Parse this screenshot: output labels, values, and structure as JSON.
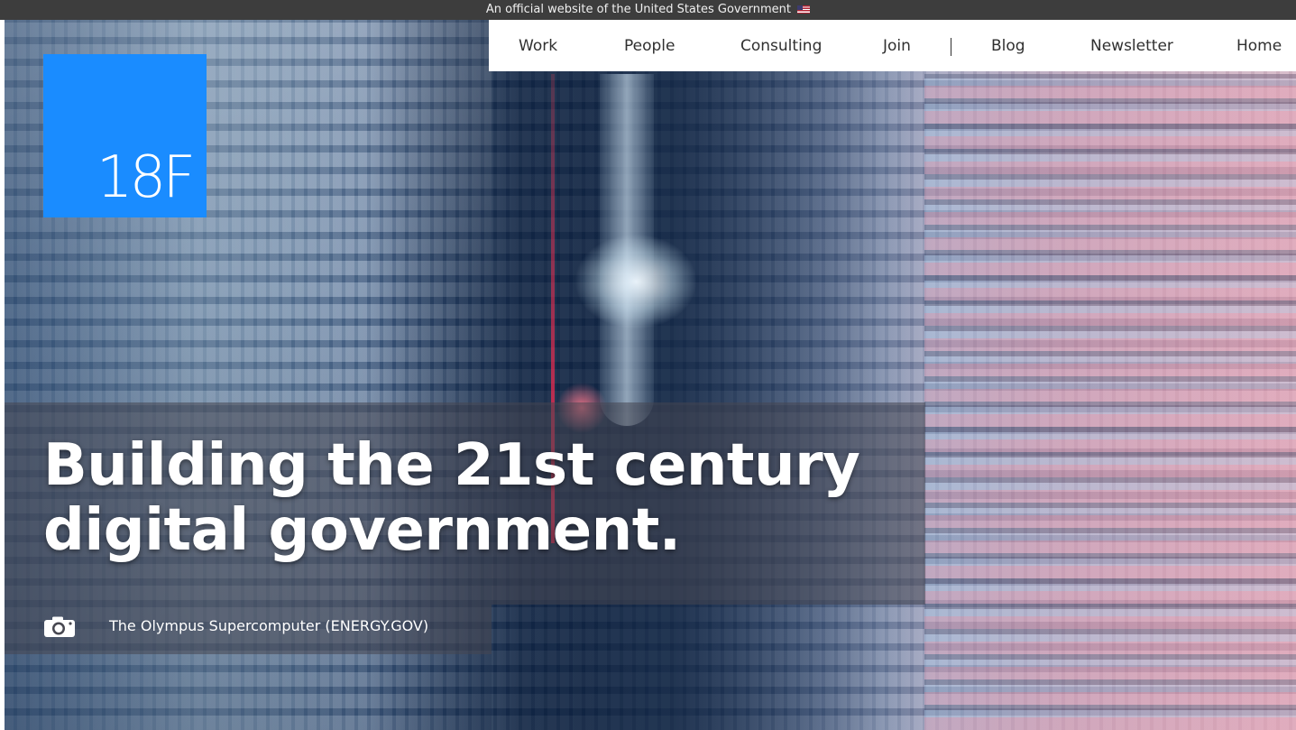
{
  "gov_banner": {
    "text": "An official website of the United States Government",
    "flag_icon": "us-flag-icon"
  },
  "logo": {
    "text": "18F",
    "color": "#1a8cff"
  },
  "nav": {
    "items": [
      {
        "label": "Work"
      },
      {
        "label": "People"
      },
      {
        "label": "Consulting"
      },
      {
        "label": "Join"
      },
      {
        "label": "Blog"
      },
      {
        "label": "Newsletter"
      },
      {
        "label": "Home"
      }
    ],
    "separator": "|"
  },
  "hero": {
    "headline_line1": "Building the 21st century",
    "headline_line2": "digital government.",
    "caption_icon": "camera-icon",
    "caption": "The Olympus Supercomputer (ENERGY.GOV)"
  }
}
